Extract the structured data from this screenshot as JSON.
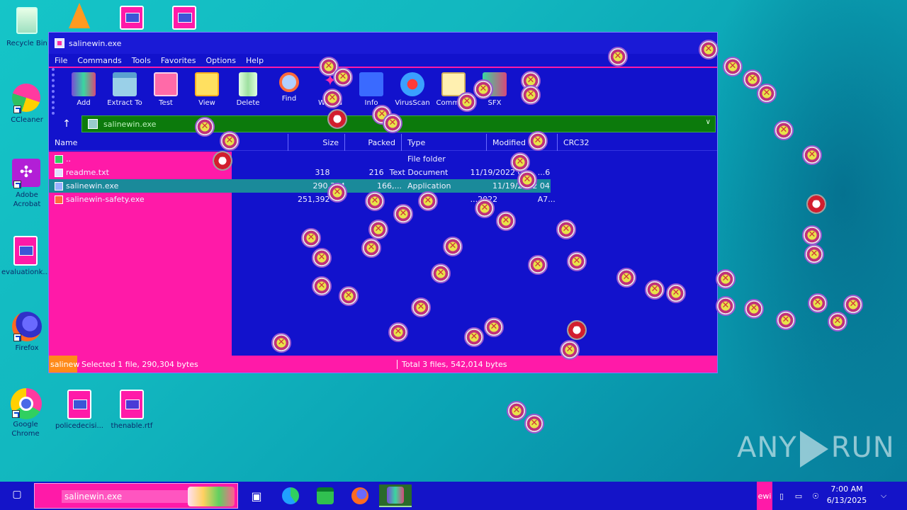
{
  "desktop": {
    "icons": [
      {
        "label": "Recycle Bin"
      },
      {
        "label": "CCleaner"
      },
      {
        "label": "Adobe Acrobat"
      },
      {
        "label": "evaluationk..."
      },
      {
        "label": "Firefox"
      },
      {
        "label": "Google Chrome"
      },
      {
        "label": "policedecisi..."
      },
      {
        "label": "thenable.rtf"
      }
    ]
  },
  "window": {
    "title": "salinewin.exe",
    "menu": [
      "File",
      "Commands",
      "Tools",
      "Favorites",
      "Options",
      "Help"
    ],
    "toolbar": [
      "Add",
      "Extract To",
      "Test",
      "View",
      "Delete",
      "Find",
      "Wizard",
      "Info",
      "VirusScan",
      "Comment",
      "SFX"
    ],
    "address": "salinewin.exe",
    "columns": [
      "Name",
      "Size",
      "Packed",
      "Type",
      "Modified",
      "CRC32"
    ],
    "files": [
      {
        "name": "..",
        "size": "",
        "packed": "",
        "type": "File folder",
        "modified": "",
        "crc": ""
      },
      {
        "name": "readme.txt",
        "size": "318",
        "packed": "216",
        "type": "Text Document",
        "modified": "11/19/2022 04...",
        "crc": "...6"
      },
      {
        "name": "salinewin.exe",
        "size": "290,304",
        "packed": "166,...",
        "type": "Application",
        "modified": "11/19/2022 04...",
        "crc": ""
      },
      {
        "name": "salinewin-safety.exe",
        "size": "251,392",
        "packed": "",
        "type": "",
        "modified": "...2022",
        "crc": "A7..."
      }
    ],
    "status_left_tag": "salinew",
    "status_selected": "Selected 1 file, 290,304 bytes",
    "status_total": "Total 3 files, 542,014 bytes"
  },
  "taskbar": {
    "search_value": "salinewin.exe",
    "time": "7:00 AM",
    "date": "6/13/2025",
    "tray_tag": "ewi"
  },
  "watermark": {
    "left": "ANY",
    "right": "RUN"
  }
}
